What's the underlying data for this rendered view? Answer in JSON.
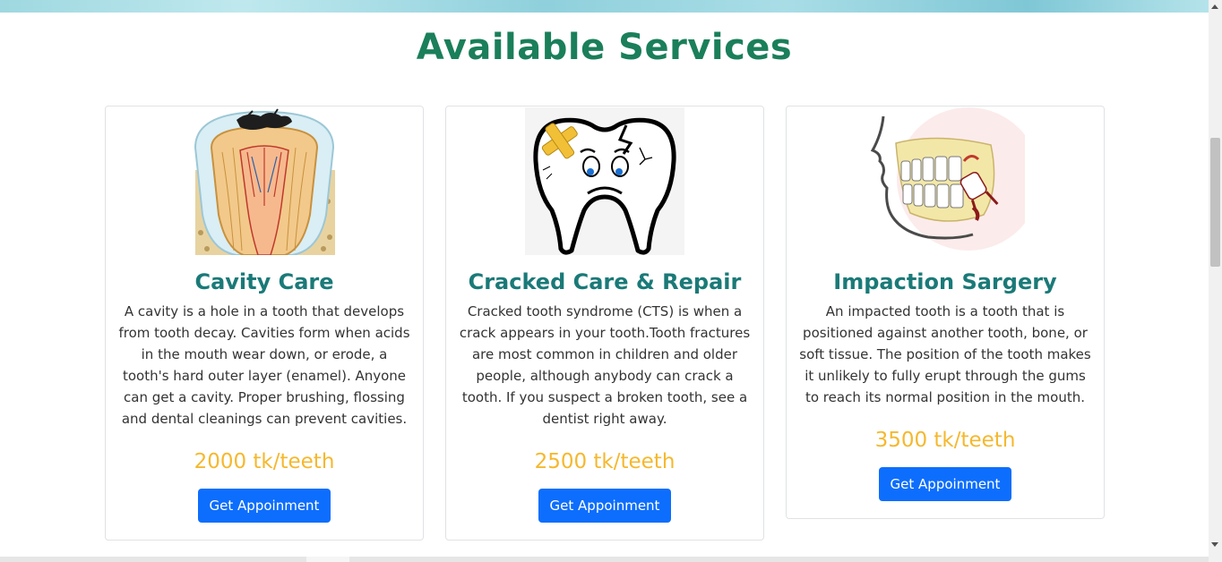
{
  "page": {
    "title": "Available Services"
  },
  "services": [
    {
      "title": "Cavity Care",
      "description": "A cavity is a hole in a tooth that develops from tooth decay. Cavities form when acids in the mouth wear down, or erode, a tooth's hard outer layer (enamel). Anyone can get a cavity. Proper brushing, flossing and dental cleanings can prevent cavities.",
      "price": "2000 tk/teeth",
      "button_label": "Get Appoinment",
      "image": "tooth-cavity-cross-section-illustration"
    },
    {
      "title": "Cracked Care & Repair",
      "description": "Cracked tooth syndrome (CTS) is when a crack appears in your tooth.Tooth fractures are most common in children and older people, although anybody can crack a tooth. If you suspect a broken tooth, see a dentist right away.",
      "price": "2500 tk/teeth",
      "button_label": "Get Appoinment",
      "image": "sad-cracked-tooth-cartoon"
    },
    {
      "title": "Impaction Sargery",
      "description": "An impacted tooth is a tooth that is positioned against another tooth, bone, or soft tissue. The position of the tooth makes it unlikely to fully erupt through the gums to reach its normal position in the mouth.",
      "price": "3500 tk/teeth",
      "button_label": "Get Appoinment",
      "image": "impacted-wisdom-tooth-jaw-illustration"
    }
  ],
  "colors": {
    "heading": "#1a7f5a",
    "card_title": "#1a7a78",
    "price": "#f5b82e",
    "button": "#0d6efd"
  }
}
